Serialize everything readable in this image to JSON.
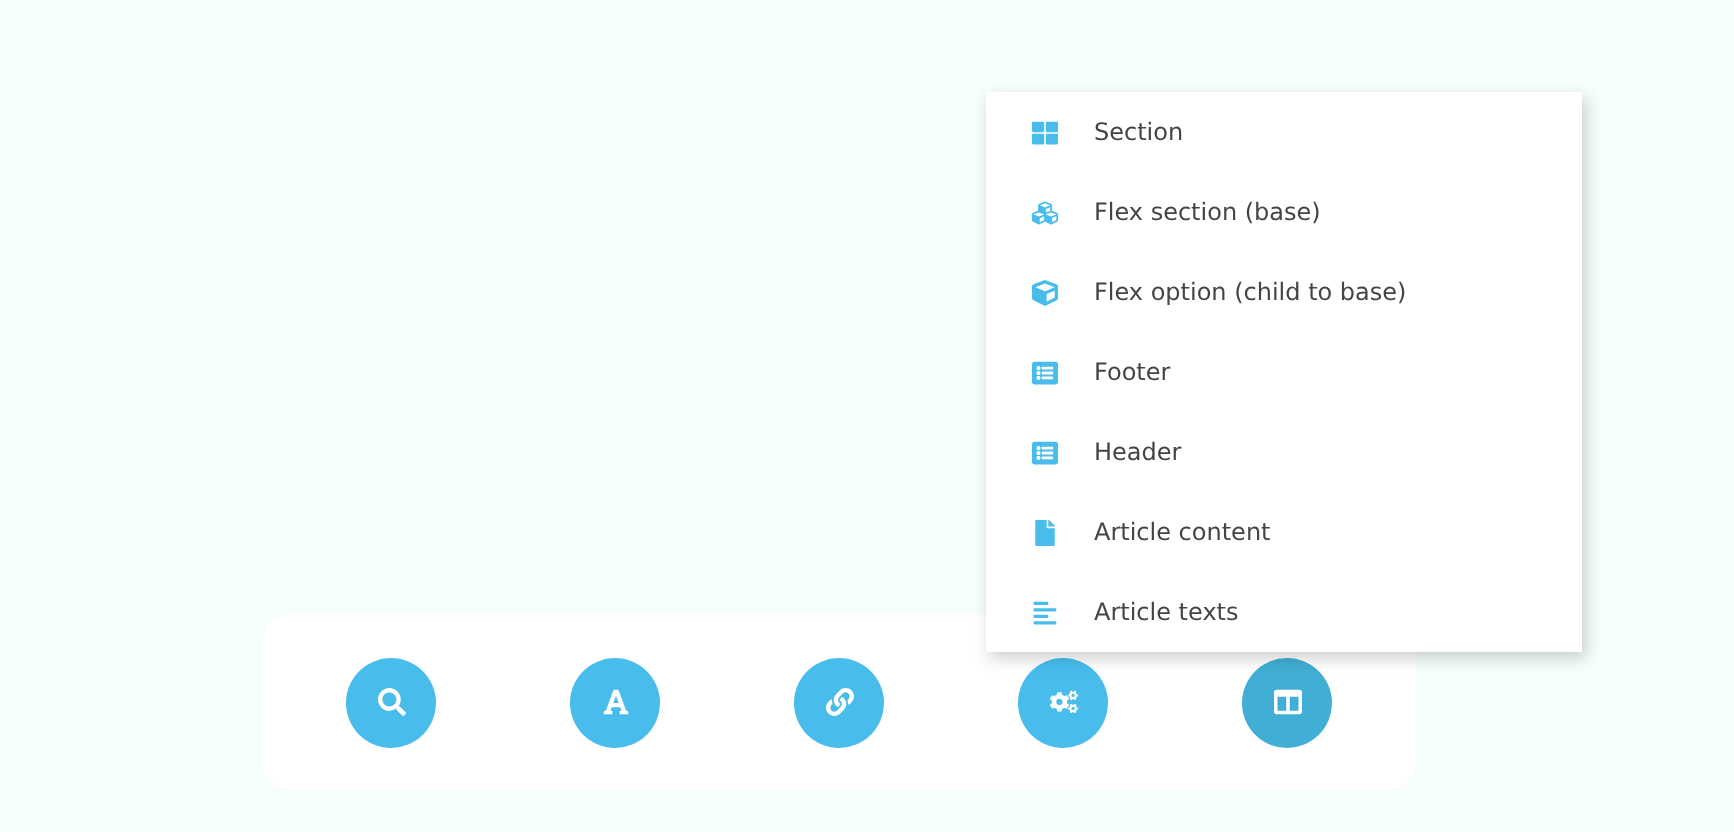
{
  "toolbar": {
    "buttons": [
      {
        "kind": "search",
        "selected": false
      },
      {
        "kind": "font",
        "selected": false
      },
      {
        "kind": "link",
        "selected": false
      },
      {
        "kind": "settings",
        "selected": false
      },
      {
        "kind": "layout",
        "selected": true
      }
    ]
  },
  "menu": {
    "items": [
      {
        "kind": "section",
        "label": "Section"
      },
      {
        "kind": "flex-section",
        "label": "Flex section (base)"
      },
      {
        "kind": "flex-option",
        "label": "Flex option (child to base)"
      },
      {
        "kind": "footer",
        "label": "Footer"
      },
      {
        "kind": "header",
        "label": "Header"
      },
      {
        "kind": "article-content",
        "label": "Article content"
      },
      {
        "kind": "article-texts",
        "label": "Article texts"
      }
    ]
  }
}
